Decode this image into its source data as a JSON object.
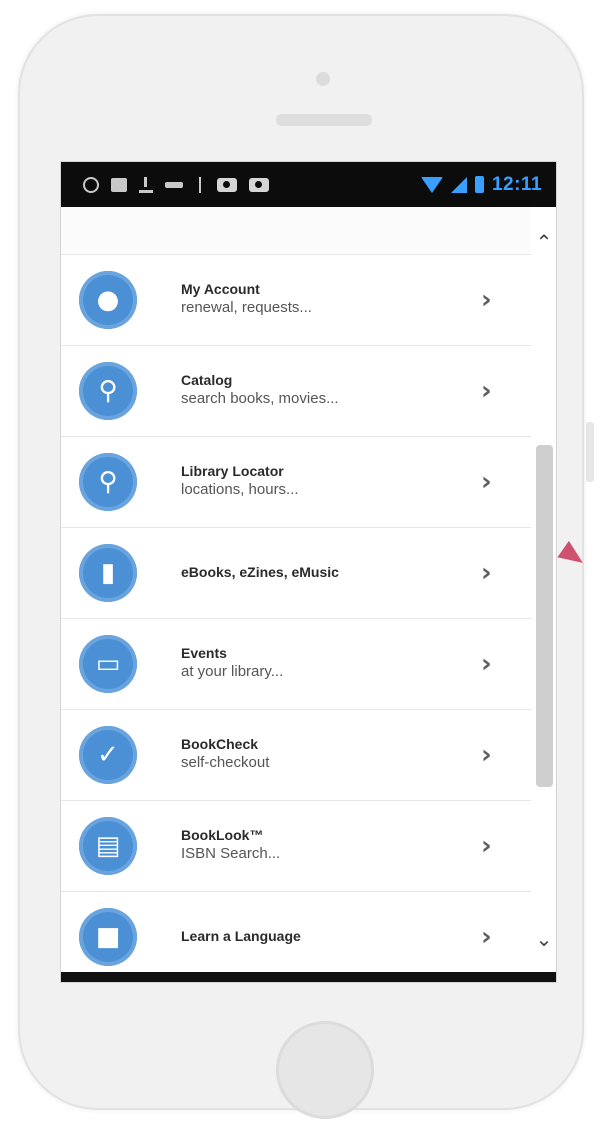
{
  "status_bar": {
    "time": "12:11",
    "left_icons": [
      "ring-icon",
      "keyboard-icon",
      "download-icon",
      "voicemail-icon",
      "usb-icon",
      "camera-icon",
      "camera-icon"
    ],
    "right_icons": [
      "wifi-icon",
      "signal-icon",
      "battery-icon"
    ],
    "accent_color": "#3aa0ff"
  },
  "menu": {
    "items": [
      {
        "title": "My Account",
        "subtitle": "renewal, requests...",
        "icon": "person-icon"
      },
      {
        "title": "Catalog",
        "subtitle": "search books, movies...",
        "icon": "magnifier-icon"
      },
      {
        "title": "Library Locator",
        "subtitle": "locations, hours...",
        "icon": "map-pin-icon"
      },
      {
        "title": "eBooks, eZines, eMusic",
        "subtitle": "",
        "icon": "ebook-icon"
      },
      {
        "title": "Events",
        "subtitle": "at your library...",
        "icon": "calendar-icon"
      },
      {
        "title": "BookCheck",
        "subtitle": "self-checkout",
        "icon": "checkout-icon"
      },
      {
        "title": "BookLook™",
        "subtitle": "ISBN Search...",
        "icon": "isbn-icon"
      },
      {
        "title": "Learn a Language",
        "subtitle": "",
        "icon": "language-icon"
      }
    ],
    "icon_color": "#4b8fd4"
  },
  "scroll": {
    "up_glyph": "⌃",
    "down_glyph": "⌄",
    "chevron_glyph": "›"
  }
}
